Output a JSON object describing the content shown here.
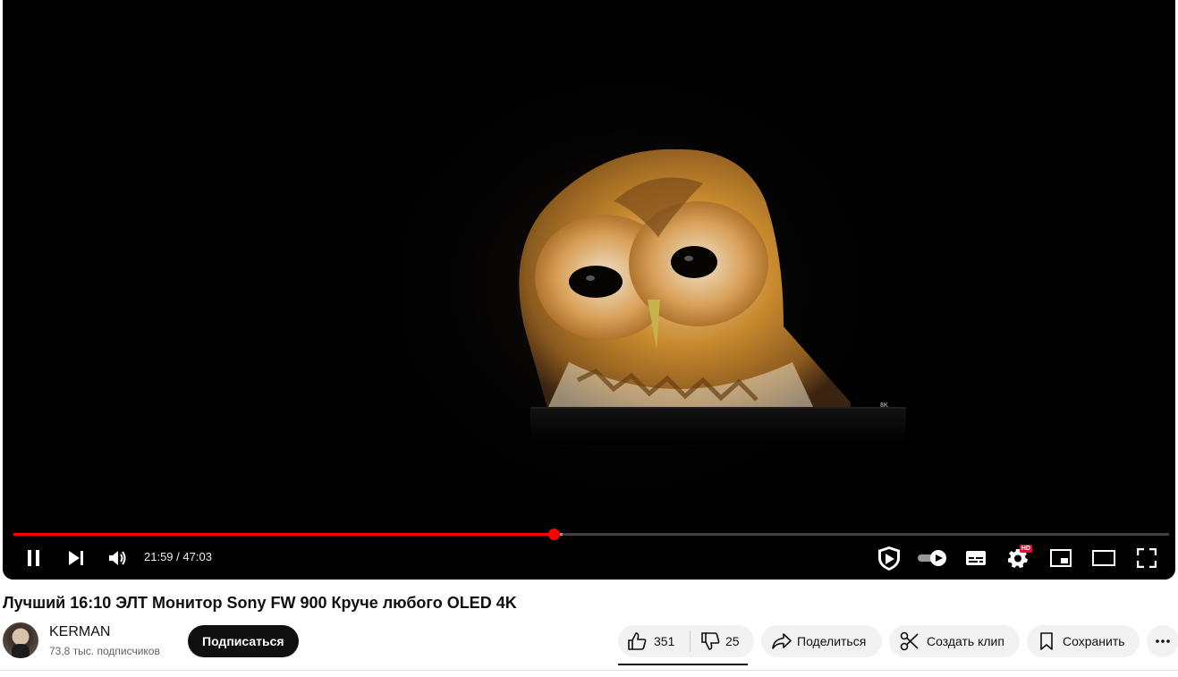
{
  "player": {
    "time_current": "21:59",
    "time_separator": " / ",
    "time_total": "47:03",
    "progress_fraction": 0.4675,
    "buffered_fraction": 0.475,
    "accent_color": "#ff0000",
    "hd_badge": "HD",
    "monitor_brand": "8K",
    "controls": [
      "pause-icon",
      "next-icon",
      "volume-icon",
      "shield-play-icon",
      "autoplay-toggle-icon",
      "subtitles-icon",
      "settings-icon",
      "miniplayer-icon",
      "theater-mode-icon",
      "fullscreen-icon"
    ]
  },
  "video": {
    "title": "Лучший 16:10 ЭЛТ Монитор Sony FW 900 Круче любого OLED 4K"
  },
  "channel": {
    "name": "KERMAN",
    "subscribers": "73,8 тыс. подписчиков",
    "subscribe_label": "Подписаться"
  },
  "actions": {
    "likes": "351",
    "dislikes": "25",
    "share_label": "Поделиться",
    "clip_label": "Создать клип",
    "save_label": "Сохранить"
  }
}
